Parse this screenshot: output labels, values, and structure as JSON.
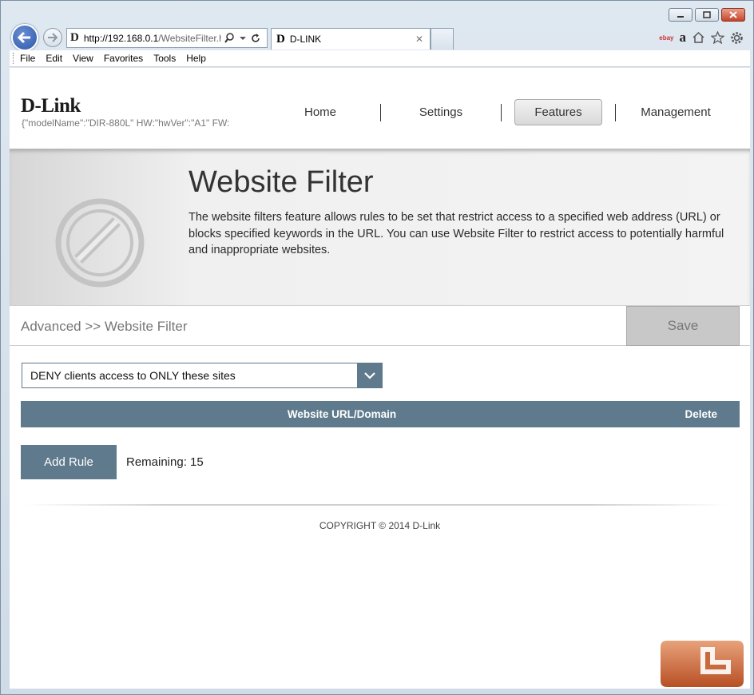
{
  "browser": {
    "address": {
      "host": "http://192.168.0.1",
      "path": "/WebsiteFilter.html"
    },
    "tab_title": "D-LINK",
    "menu": [
      "File",
      "Edit",
      "View",
      "Favorites",
      "Tools",
      "Help"
    ],
    "toolbar": {
      "ebay": "ebay",
      "amazon": "a"
    }
  },
  "header": {
    "logo": "D-Link",
    "model_info": "{\"modelName\":\"DIR-880L\"   HW:\"hwVer\":\"A1\"   FW:",
    "nav": [
      "Home",
      "Settings",
      "Features",
      "Management"
    ],
    "active_nav": "Features"
  },
  "banner": {
    "title": "Website Filter",
    "description": "The website filters feature allows rules to be set that restrict access to a specified web address (URL) or blocks specified keywords in the URL. You can use Website Filter to restrict access to potentially harmful and inappropriate websites."
  },
  "breadcrumb": "Advanced >> Website Filter",
  "save_label": "Save",
  "filter_mode": {
    "selected": "DENY clients access to ONLY these sites"
  },
  "table": {
    "columns": [
      "Website URL/Domain",
      "Delete"
    ]
  },
  "add_rule_label": "Add Rule",
  "remaining": "Remaining: 15",
  "copyright": "COPYRIGHT © 2014 D-Link",
  "colors": {
    "accent": "#5e7a8c",
    "save_disabled": "#c8c8c8"
  }
}
